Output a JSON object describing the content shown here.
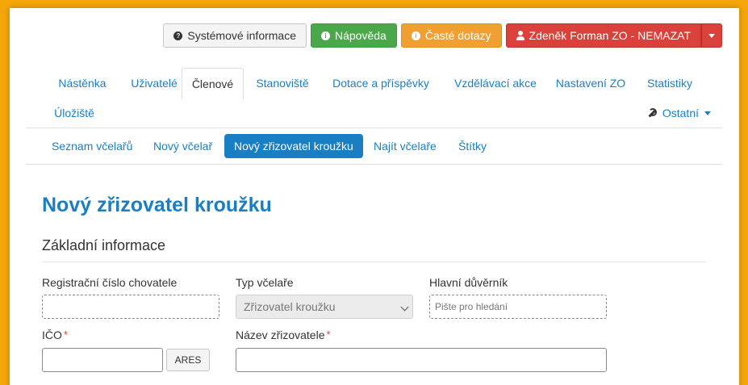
{
  "topbar": {
    "system_info": "Systémové informace",
    "help": "Nápověda",
    "faq": "Časté dotazy",
    "user": "Zdeněk Forman ZO - NEMAZAT"
  },
  "mainnav": {
    "tabs": [
      "Nástěnka",
      "Uživatelé",
      "Členové",
      "Stanoviště",
      "Dotace a příspěvky",
      "Vzdělávací akce",
      "Nastavení ZO",
      "Statistiky",
      "Úložiště"
    ],
    "active": "Členové",
    "other": "Ostatní"
  },
  "subnav": {
    "items": [
      "Seznam včelařů",
      "Nový včelař",
      "Nový zřizovatel kroužku",
      "Najít včelaře",
      "Štítky"
    ],
    "active": "Nový zřizovatel kroužku"
  },
  "page": {
    "title": "Nový zřizovatel kroužku",
    "section": "Základní informace"
  },
  "form": {
    "reg_number_label": "Registrační číslo chovatele",
    "type_label": "Typ včelaře",
    "type_value": "Zřizovatel kroužku",
    "main_trustee_label": "Hlavní důvěrník",
    "main_trustee_placeholder": "Pište pro hledání",
    "ico_label": "IČO",
    "ares_button": "ARES",
    "founder_name_label": "Název zřizovatele"
  },
  "colors": {
    "frame_bg": "#f5a70a",
    "accent": "#1a7fc2",
    "success": "#4aa84a",
    "warning": "#f0a030",
    "danger": "#d9413a"
  }
}
